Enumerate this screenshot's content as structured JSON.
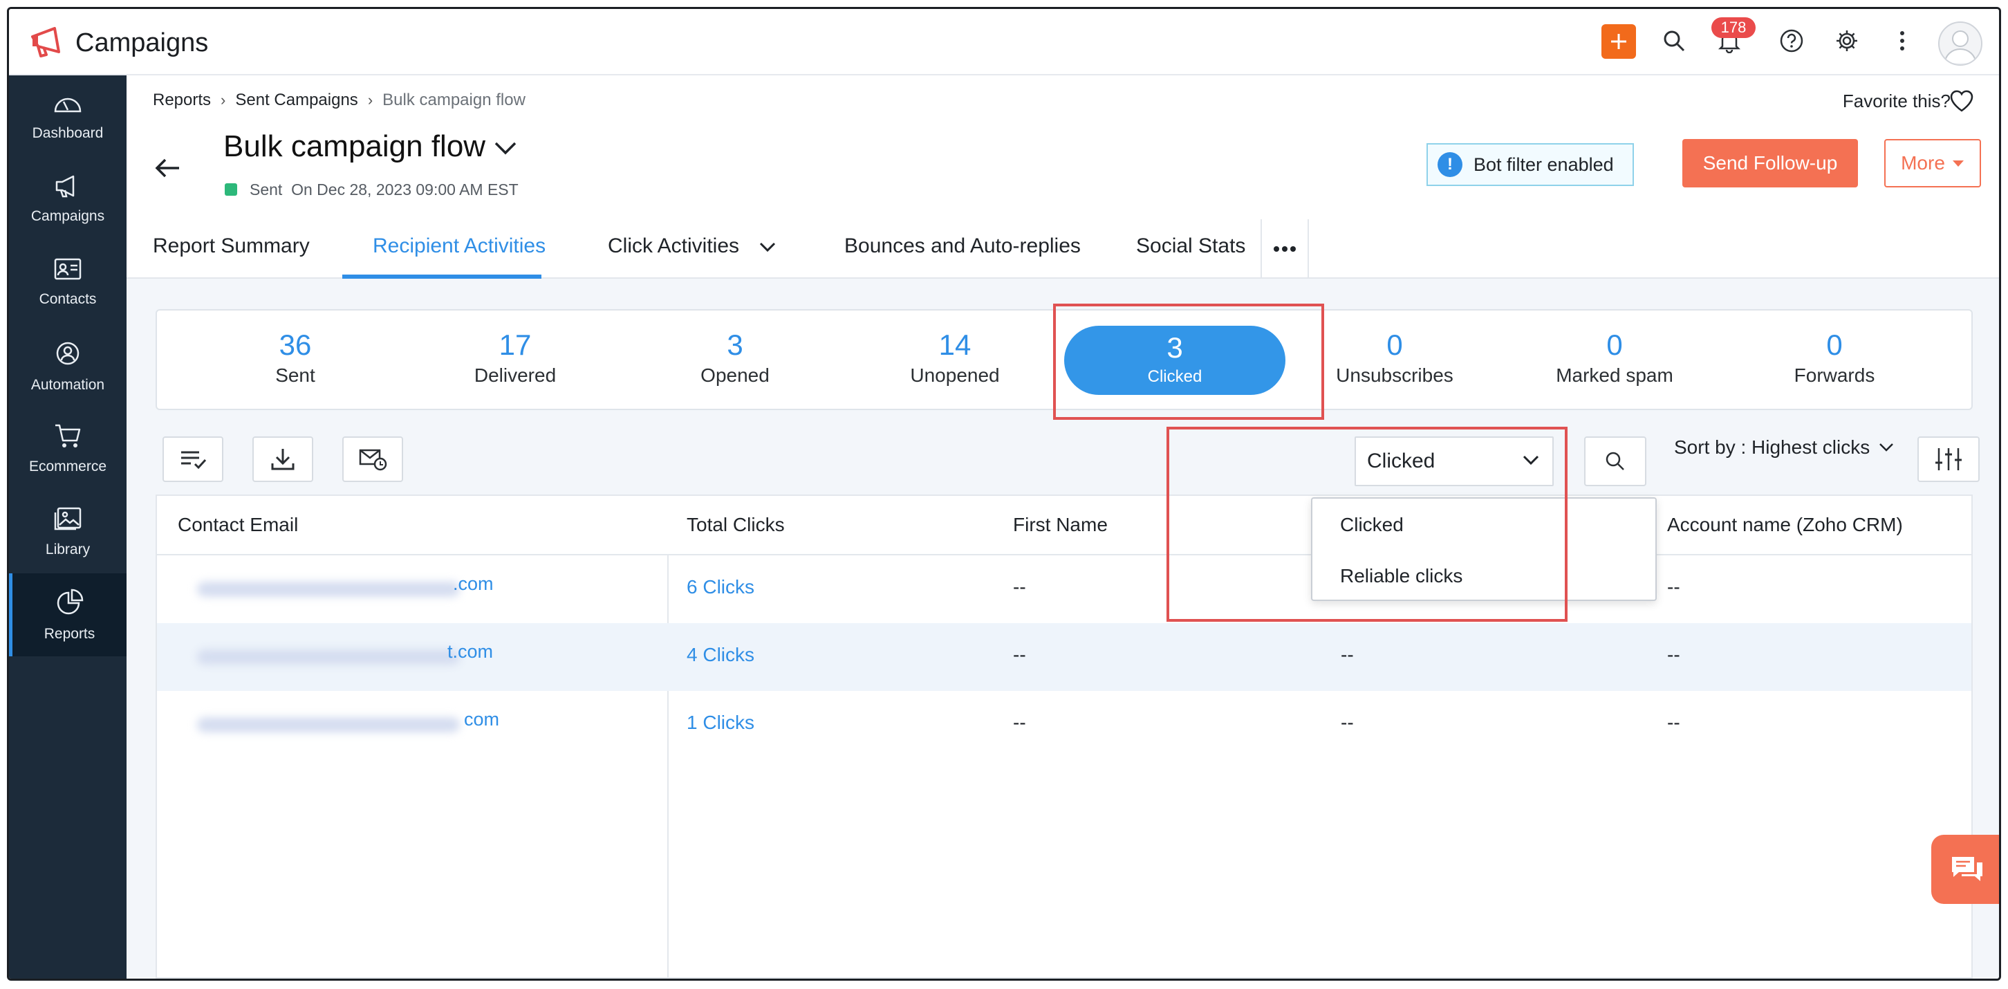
{
  "app": {
    "title": "Campaigns"
  },
  "header": {
    "notification_count": "178"
  },
  "sidebar": {
    "items": [
      {
        "label": "Dashboard"
      },
      {
        "label": "Campaigns"
      },
      {
        "label": "Contacts"
      },
      {
        "label": "Automation"
      },
      {
        "label": "Ecommerce"
      },
      {
        "label": "Library"
      },
      {
        "label": "Reports"
      }
    ]
  },
  "breadcrumb": {
    "items": [
      "Reports",
      "Sent Campaigns",
      "Bulk campaign flow"
    ]
  },
  "favorite": {
    "label": "Favorite this?"
  },
  "campaign": {
    "title": "Bulk campaign flow",
    "status": "Sent",
    "sent_on": "On Dec 28, 2023 09:00 AM EST"
  },
  "actions": {
    "bot_filter": "Bot filter enabled",
    "follow_up": "Send Follow-up",
    "more": "More"
  },
  "tabs": [
    "Report Summary",
    "Recipient Activities",
    "Click Activities",
    "Bounces and Auto-replies",
    "Social Stats"
  ],
  "stats": [
    {
      "num": "36",
      "label": "Sent"
    },
    {
      "num": "17",
      "label": "Delivered"
    },
    {
      "num": "3",
      "label": "Opened"
    },
    {
      "num": "14",
      "label": "Unopened"
    },
    {
      "num": "3",
      "label": "Clicked"
    },
    {
      "num": "0",
      "label": "Unsubscribes"
    },
    {
      "num": "0",
      "label": "Marked spam"
    },
    {
      "num": "0",
      "label": "Forwards"
    }
  ],
  "toolbar": {
    "filter_value": "Clicked",
    "sort_by": "Sort by : Highest clicks"
  },
  "dropdown": {
    "options": [
      "Clicked",
      "Reliable clicks"
    ]
  },
  "table": {
    "headers": [
      "Contact Email",
      "Total Clicks",
      "First Name",
      "Account name (Zoho CRM)"
    ],
    "rows": [
      {
        "email_suffix": ".com",
        "clicks": "6  Clicks",
        "first_name": "--",
        "col4": "--",
        "account": "--"
      },
      {
        "email_suffix": "t.com",
        "clicks": "4  Clicks",
        "first_name": "--",
        "col4": "--",
        "account": "--"
      },
      {
        "email_suffix": "com",
        "clicks": "1  Clicks",
        "first_name": "--",
        "col4": "--",
        "account": "--"
      }
    ]
  },
  "colors": {
    "accent": "#2f8ee6",
    "brand": "#f47153",
    "sidebar": "#1c2b3a",
    "highlight": "#e05252"
  }
}
